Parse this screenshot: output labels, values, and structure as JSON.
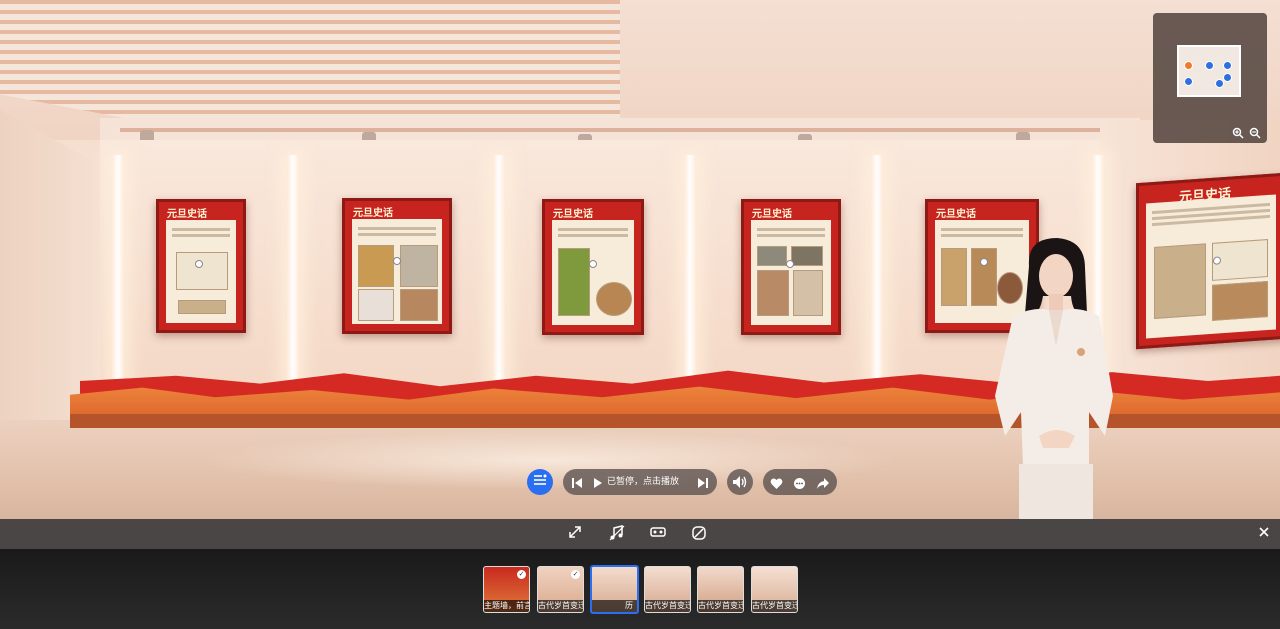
{
  "hall": {
    "poster_title": "元旦史话"
  },
  "controls": {
    "list_icon": "playlist-icon",
    "prev_icon": "skip-previous-icon",
    "play_icon": "play-icon",
    "status_text": "已暂停，点击播放",
    "next_icon": "skip-next-icon",
    "volume_icon": "volume-icon",
    "like_icon": "heart-icon",
    "comment_icon": "comment-icon",
    "share_icon": "share-icon"
  },
  "toolbar": {
    "icons": [
      "fullscreen-icon",
      "music-icon",
      "vr-icon",
      "gyroscope-icon"
    ],
    "close_icon": "close-icon"
  },
  "minimap": {
    "zoom_in_icon": "zoom-in-icon",
    "zoom_out_icon": "zoom-out-icon"
  },
  "scenes": [
    {
      "label": "主题墙，前言",
      "checked": true,
      "active": false
    },
    {
      "label": "古代岁首变迁",
      "checked": true,
      "active": false
    },
    {
      "label": "历",
      "checked": false,
      "active": true
    },
    {
      "label": "古代岁首变迁",
      "checked": false,
      "active": false
    },
    {
      "label": "古代岁首变迁",
      "checked": false,
      "active": false
    },
    {
      "label": "古代岁首变迁",
      "checked": false,
      "active": false
    }
  ],
  "colors": {
    "accent": "#2a6ff2",
    "poster_red": "#c8241f",
    "ribbon_orange": "#f18a3e"
  }
}
